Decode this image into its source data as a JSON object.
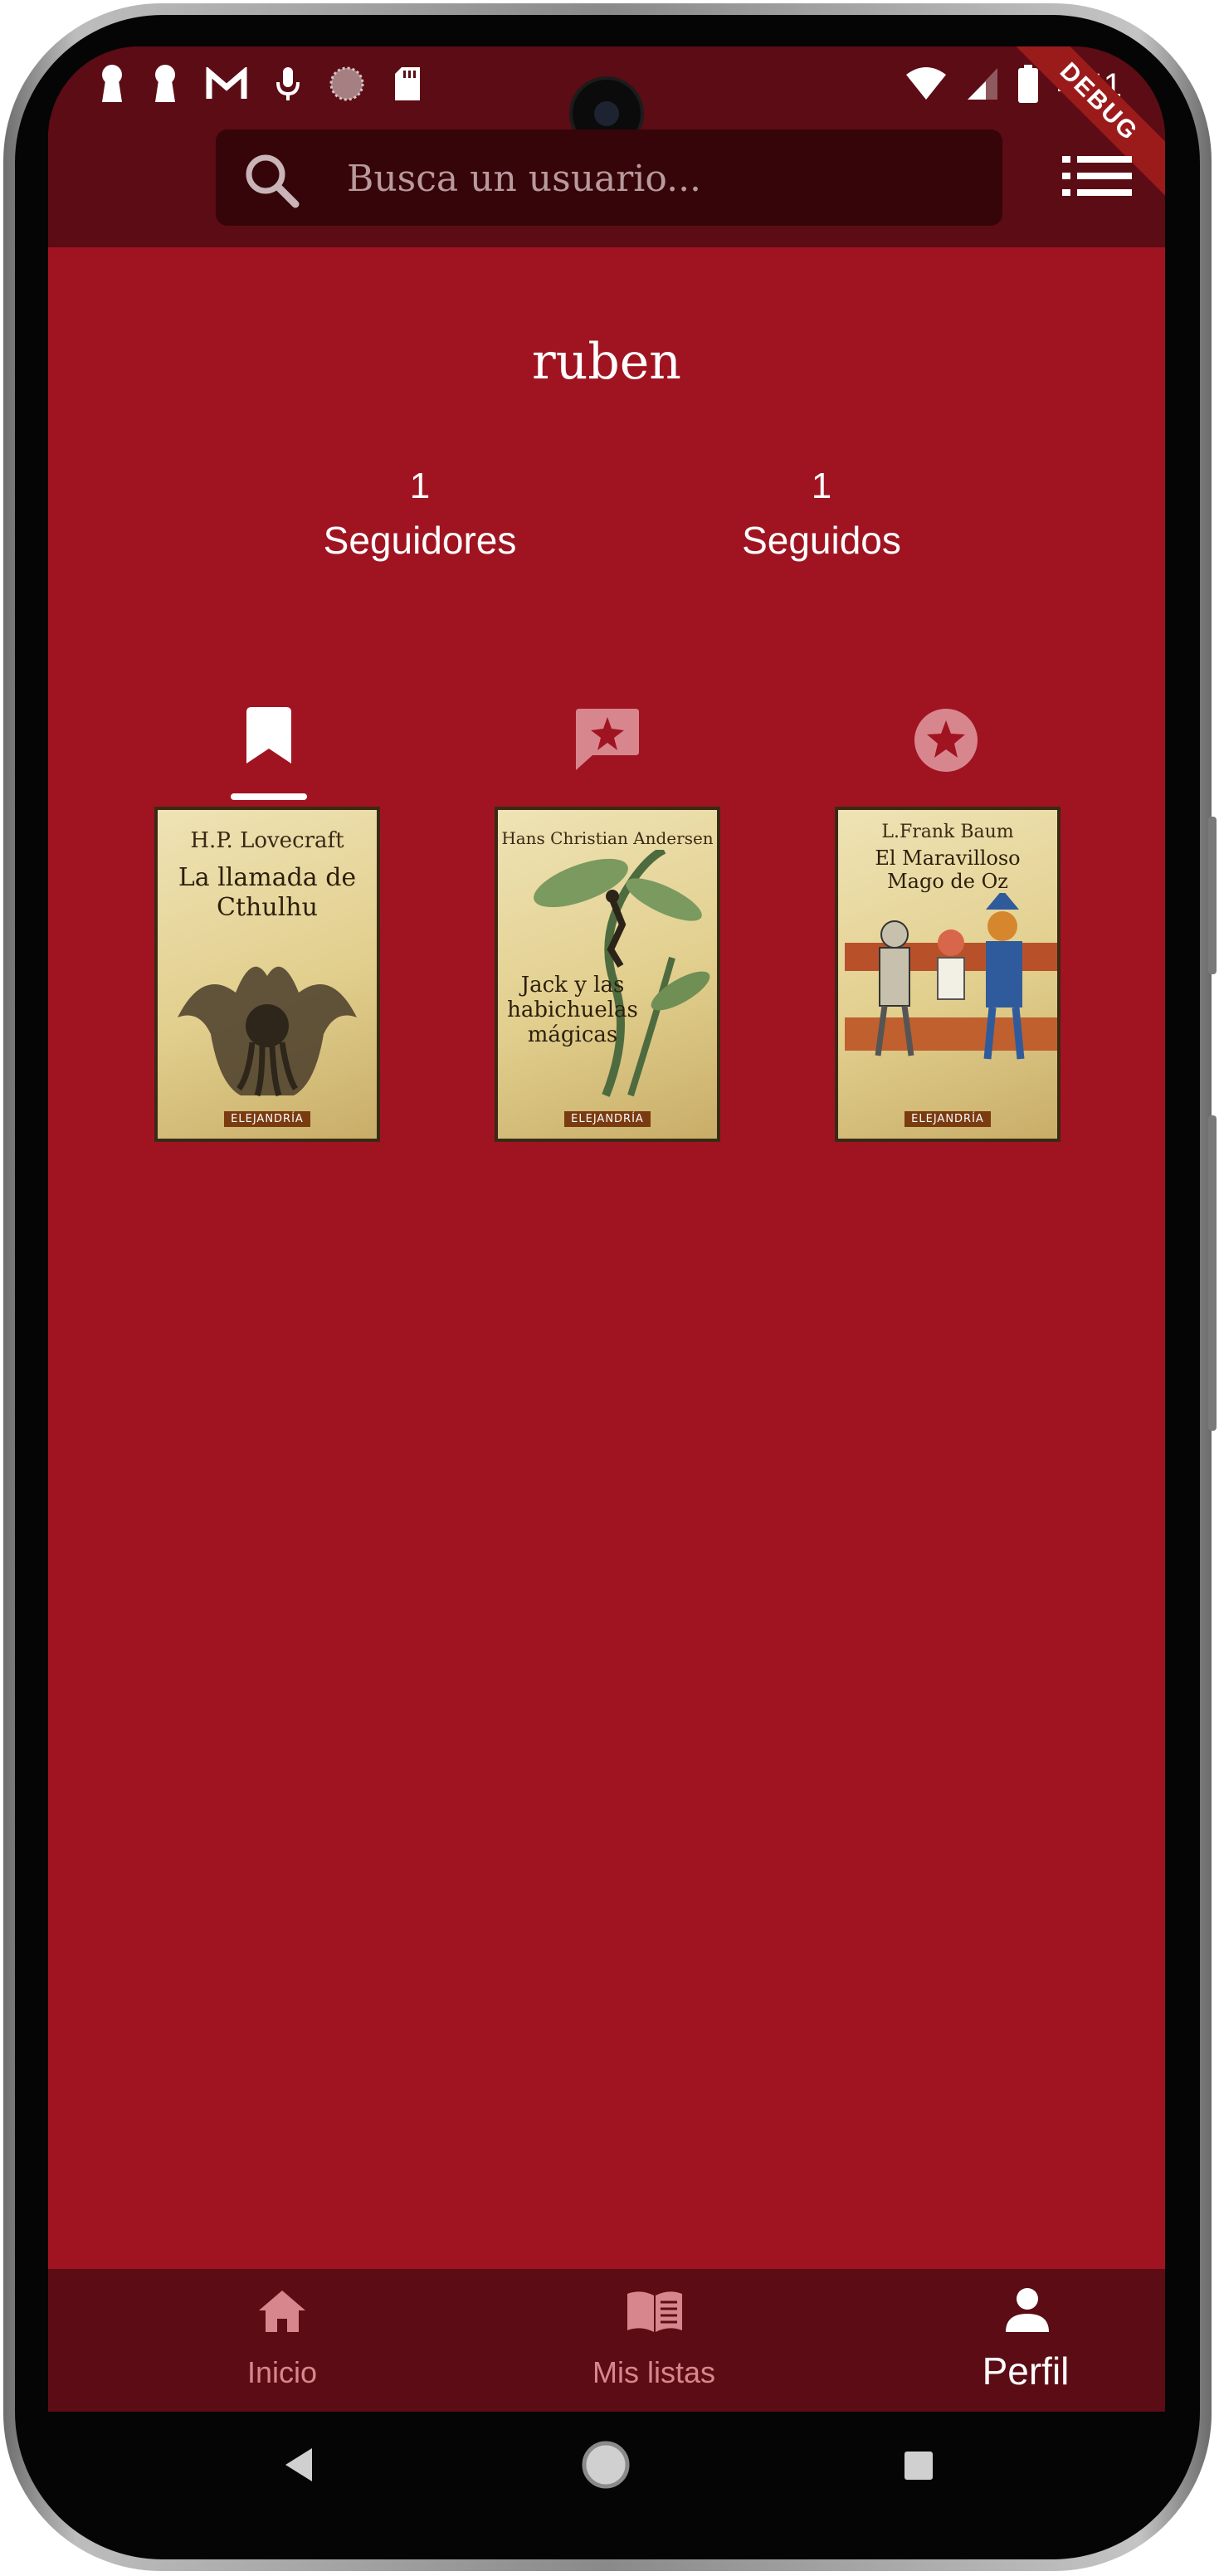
{
  "status_bar": {
    "time": "4:41",
    "debug_label": "DEBUG",
    "left_icons": [
      "keyhole-icon",
      "keyhole-icon",
      "gmail-icon",
      "mic-icon",
      "dot-circle-icon",
      "sd-card-icon"
    ],
    "right_icons": [
      "wifi-icon",
      "signal-icon",
      "battery-icon"
    ]
  },
  "app_bar": {
    "search_placeholder": "Busca un usuario...",
    "search_icon": "search-icon",
    "menu_icon": "list-icon"
  },
  "profile": {
    "username": "ruben",
    "followers_count": "1",
    "followers_label": "Seguidores",
    "following_count": "1",
    "following_label": "Seguidos"
  },
  "tabs": [
    {
      "icon": "bookmark-icon",
      "selected": true
    },
    {
      "icon": "review-star-icon",
      "selected": false
    },
    {
      "icon": "star-circle-icon",
      "selected": false
    }
  ],
  "books": [
    {
      "author": "H.P. Lovecraft",
      "title": "La llamada de Cthulhu",
      "publisher": "ELEJANDRÍA"
    },
    {
      "author": "Hans Christian Andersen",
      "title": "Jack y las habichuelas mágicas",
      "publisher": "ELEJANDRÍA"
    },
    {
      "author": "L.Frank Baum",
      "title": "El Maravilloso Mago de Oz",
      "publisher": "ELEJANDRÍA"
    }
  ],
  "bottom_nav": {
    "items": [
      {
        "label": "Inicio",
        "icon": "home-icon",
        "selected": false
      },
      {
        "label": "Mis listas",
        "icon": "book-icon",
        "selected": false
      },
      {
        "label": "Perfil",
        "icon": "person-icon",
        "selected": true
      }
    ]
  },
  "colors": {
    "background": "#a01421",
    "bar": "#5c0c14",
    "search_field": "#360509",
    "inactive_icon": "#d8868e",
    "active_icon": "#ffffff"
  }
}
